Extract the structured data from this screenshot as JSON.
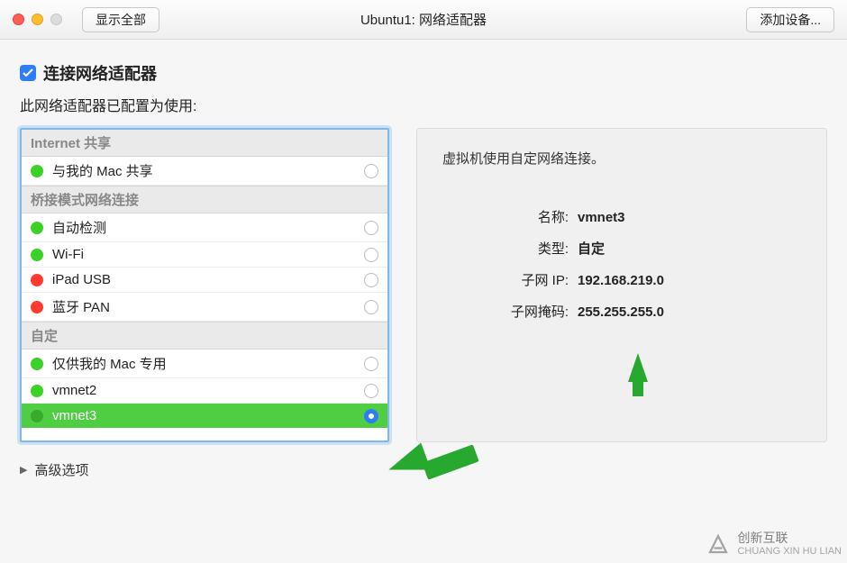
{
  "titlebar": {
    "show_all": "显示全部",
    "title": "Ubuntu1: 网络适配器",
    "add_device": "添加设备..."
  },
  "connect": {
    "checked": true,
    "label": "连接网络适配器"
  },
  "subtitle": "此网络适配器已配置为使用:",
  "list": {
    "groups": [
      {
        "header": "Internet 共享",
        "items": [
          {
            "label": "与我的 Mac 共享",
            "status": "green",
            "selected": false
          }
        ]
      },
      {
        "header": "桥接模式网络连接",
        "items": [
          {
            "label": "自动检测",
            "status": "green",
            "selected": false
          },
          {
            "label": "Wi-Fi",
            "status": "green",
            "selected": false
          },
          {
            "label": "iPad USB",
            "status": "red",
            "selected": false
          },
          {
            "label": "蓝牙 PAN",
            "status": "red",
            "selected": false
          }
        ]
      },
      {
        "header": "自定",
        "items": [
          {
            "label": "仅供我的 Mac 专用",
            "status": "green",
            "selected": false
          },
          {
            "label": "vmnet2",
            "status": "green",
            "selected": false
          },
          {
            "label": "vmnet3",
            "status": "green",
            "selected": true
          }
        ]
      }
    ]
  },
  "details": {
    "description": "虚拟机使用自定网络连接。",
    "name_label": "名称:",
    "name_value": "vmnet3",
    "type_label": "类型:",
    "type_value": "自定",
    "subnet_ip_label": "子网 IP:",
    "subnet_ip_value": "192.168.219.0",
    "subnet_mask_label": "子网掩码:",
    "subnet_mask_value": "255.255.255.0"
  },
  "advanced": "高级选项",
  "watermark": {
    "cn": "创新互联",
    "en": "CHUANG XIN HU LIAN"
  }
}
